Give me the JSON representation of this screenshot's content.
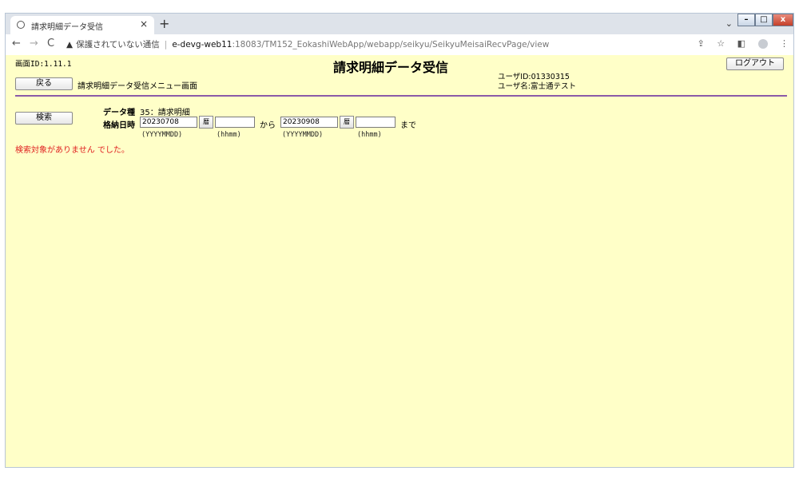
{
  "browser": {
    "tab_title": "請求明細データ受信",
    "tab_close": "×",
    "new_tab": "+",
    "nav_back": "←",
    "nav_forward": "→",
    "nav_reload": "C",
    "warn_glyph": "▲",
    "insecure_label": "保護されていない通信",
    "separator": "|",
    "url_host": "e-devg-web11",
    "url_path": ":18083/TM152_EokashiWebApp/webapp/seikyu/SeikyuMeisaiRecvPage/view",
    "chevron": "⌄",
    "win_min": "–",
    "win_max": "□",
    "win_close": "x",
    "icon_share": "⇪",
    "icon_star": "☆",
    "icon_panel": "◧",
    "icon_menu": "⋮"
  },
  "page": {
    "screen_id": "画面ID:1.11.1",
    "title": "請求明細データ受信",
    "logout_label": "ログアウト",
    "back_label": "戻る",
    "back_description": "請求明細データ受信メニュー画面",
    "user_id": "ユーザID:01330315",
    "user_name": "ユーザ名:富士通テスト",
    "search_label": "検索",
    "data_type_label": "データ種",
    "data_type_value": "35：請求明細",
    "date_label": "格納日時",
    "from_date": "20230708",
    "from_time": "",
    "from_text": "から",
    "to_date": "20230908",
    "to_time": "",
    "to_text": "まで",
    "calendar_label": "暦",
    "hint_date": "(YYYYMMDD)",
    "hint_time": "(hhmm)",
    "error_message": "検索対象がありません でした。"
  }
}
